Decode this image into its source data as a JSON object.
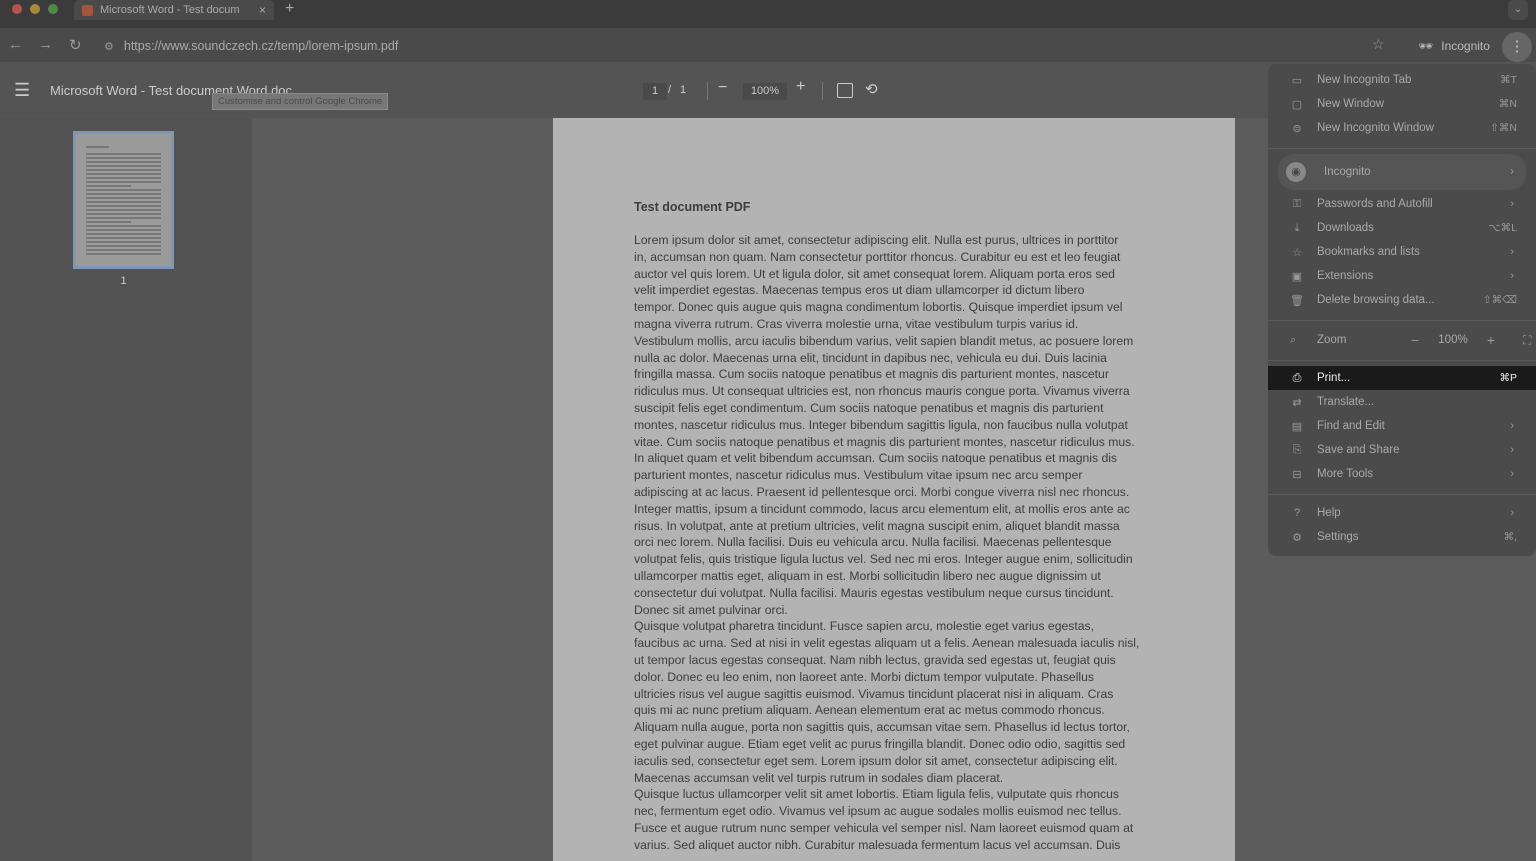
{
  "browser": {
    "tab_title": "Microsoft Word - Test docum",
    "tab_close": "×",
    "new_tab": "+",
    "tab_search": "⌄",
    "back": "←",
    "forward": "→",
    "reload": "↻",
    "url": "https://www.soundczech.cz/temp/lorem-ipsum.pdf",
    "incognito_label": "Incognito",
    "menu_button": "⋮",
    "tooltip": "Customise and control Google Chrome"
  },
  "pdf_toolbar": {
    "title": "Microsoft Word - Test document Word.doc",
    "page_current": "1",
    "page_sep": "/",
    "page_total": "1",
    "zoom_out": "−",
    "zoom": "100%",
    "zoom_in": "+"
  },
  "sidebar": {
    "thumb_label": "1"
  },
  "document": {
    "heading": "Test document PDF",
    "paragraph1": "Lorem ipsum dolor sit amet, consectetur adipiscing elit. Nulla est purus, ultrices in porttitor\nin, accumsan non quam. Nam consectetur porttitor rhoncus. Curabitur eu est et leo feugiat\nauctor vel quis lorem. Ut et ligula dolor, sit amet consequat lorem. Aliquam porta eros sed\nvelit imperdiet egestas. Maecenas tempus eros ut diam ullamcorper id dictum libero\ntempor. Donec quis augue quis magna condimentum lobortis. Quisque imperdiet ipsum vel\nmagna viverra rutrum. Cras viverra molestie urna, vitae vestibulum turpis varius id.\nVestibulum mollis, arcu iaculis bibendum varius, velit sapien blandit metus, ac posuere lorem\nnulla ac dolor. Maecenas urna elit, tincidunt in dapibus nec, vehicula eu dui. Duis lacinia\nfringilla massa. Cum sociis natoque penatibus et magnis dis parturient montes, nascetur\nridiculus mus. Ut consequat ultricies est, non rhoncus mauris congue porta. Vivamus viverra\nsuscipit felis eget condimentum. Cum sociis natoque penatibus et magnis dis parturient\nmontes, nascetur ridiculus mus. Integer bibendum sagittis ligula, non faucibus nulla volutpat\nvitae. Cum sociis natoque penatibus et magnis dis parturient montes, nascetur ridiculus mus.\nIn aliquet quam et velit bibendum accumsan. Cum sociis natoque penatibus et magnis dis\nparturient montes, nascetur ridiculus mus. Vestibulum vitae ipsum nec arcu semper\nadipiscing at ac lacus. Praesent id pellentesque orci. Morbi congue viverra nisl nec rhoncus.\nInteger mattis, ipsum a tincidunt commodo, lacus arcu elementum elit, at mollis eros ante ac\nrisus. In volutpat, ante at pretium ultricies, velit magna suscipit enim, aliquet blandit massa\norci nec lorem. Nulla facilisi. Duis eu vehicula arcu. Nulla facilisi. Maecenas pellentesque\nvolutpat felis, quis tristique ligula luctus vel. Sed nec mi eros. Integer augue enim, sollicitudin\nullamcorper mattis eget, aliquam in est. Morbi sollicitudin libero nec augue dignissim ut\nconsectetur dui volutpat. Nulla facilisi. Mauris egestas vestibulum neque cursus tincidunt.\nDonec sit amet pulvinar orci.",
    "paragraph2": "Quisque volutpat pharetra tincidunt. Fusce sapien arcu, molestie eget varius egestas,\nfaucibus ac urna. Sed at nisi in velit egestas aliquam ut a felis. Aenean malesuada iaculis nisl,\nut tempor lacus egestas consequat. Nam nibh lectus, gravida sed egestas ut, feugiat quis\ndolor. Donec eu leo enim, non laoreet ante. Morbi dictum tempor vulputate. Phasellus\nultricies risus vel augue sagittis euismod. Vivamus tincidunt placerat nisi in aliquam. Cras\nquis mi ac nunc pretium aliquam. Aenean elementum erat ac metus commodo rhoncus.\nAliquam nulla augue, porta non sagittis quis, accumsan vitae sem. Phasellus id lectus tortor,\neget pulvinar augue. Etiam eget velit ac purus fringilla blandit. Donec odio odio, sagittis sed\niaculis sed, consectetur eget sem. Lorem ipsum dolor sit amet, consectetur adipiscing elit.\nMaecenas accumsan velit vel turpis rutrum in sodales diam placerat.",
    "paragraph3": "Quisque luctus ullamcorper velit sit amet lobortis. Etiam ligula felis, vulputate quis rhoncus\nnec, fermentum eget odio. Vivamus vel ipsum ac augue sodales mollis euismod nec tellus.\nFusce et augue rutrum nunc semper vehicula vel semper nisl. Nam laoreet euismod quam at\nvarius. Sed aliquet auctor nibh. Curabitur malesuada fermentum lacus vel accumsan. Duis"
  },
  "chrome_menu": {
    "items_top": [
      {
        "label": "New Incognito Tab",
        "shortcut": "⌘T",
        "icon": "new-tab-icon"
      },
      {
        "label": "New Window",
        "shortcut": "⌘N",
        "icon": "new-window-icon"
      },
      {
        "label": "New Incognito Window",
        "shortcut": "⇧⌘N",
        "icon": "incognito-icon"
      }
    ],
    "profile_label": "Incognito",
    "items_mid": [
      {
        "label": "Passwords and Autofill",
        "shortcut": "",
        "icon": "key-icon"
      },
      {
        "label": "Downloads",
        "shortcut": "⌥⌘L",
        "icon": "download-icon"
      },
      {
        "label": "Bookmarks and lists",
        "shortcut": "",
        "icon": "star-icon"
      },
      {
        "label": "Extensions",
        "shortcut": "",
        "icon": "puzzle-icon"
      },
      {
        "label": "Delete browsing data...",
        "shortcut": "⇧⌘⌫",
        "icon": "trash-icon"
      }
    ],
    "zoom_label": "Zoom",
    "zoom_minus": "−",
    "zoom_value": "100%",
    "zoom_plus": "+",
    "items_tools": [
      {
        "label": "Print...",
        "shortcut": "⌘P",
        "icon": "print-icon"
      },
      {
        "label": "Translate...",
        "shortcut": "",
        "icon": "translate-icon"
      },
      {
        "label": "Find and Edit",
        "shortcut": "",
        "icon": "find-icon"
      },
      {
        "label": "Save and Share",
        "shortcut": "",
        "icon": "save-icon"
      },
      {
        "label": "More Tools",
        "shortcut": "",
        "icon": "toolbox-icon"
      }
    ],
    "items_bottom": [
      {
        "label": "Help",
        "shortcut": "",
        "icon": "help-icon"
      },
      {
        "label": "Settings",
        "shortcut": "⌘,",
        "icon": "gear-icon"
      }
    ]
  }
}
